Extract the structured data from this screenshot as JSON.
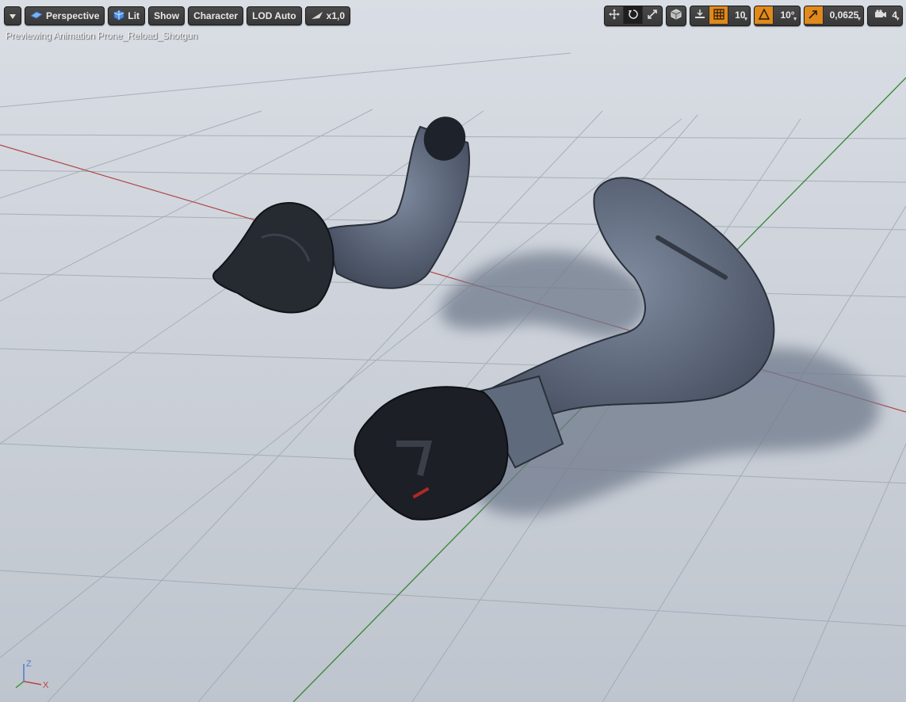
{
  "toolbar": {
    "options_icon": "chevron-down-icon",
    "perspective_label": "Perspective",
    "lit_label": "Lit",
    "show_label": "Show",
    "character_label": "Character",
    "lod_label": "LOD Auto",
    "speed_label": "x1,0"
  },
  "snap": {
    "grid_value": "10",
    "rotation_value": "10°",
    "scale_value": "0,0625",
    "camera_speed": "4"
  },
  "viewport": {
    "preview_text": "Previewing Animation Prone_Reload_Shotgun",
    "axis": {
      "z_label": "Z",
      "x_label": "X"
    }
  },
  "colors": {
    "accent_orange": "#e0891c",
    "toolbar_bg": "#3c3c3c",
    "axis_x": "#b04848",
    "axis_y": "#3e8a3e",
    "floor": "#c9ced6"
  }
}
